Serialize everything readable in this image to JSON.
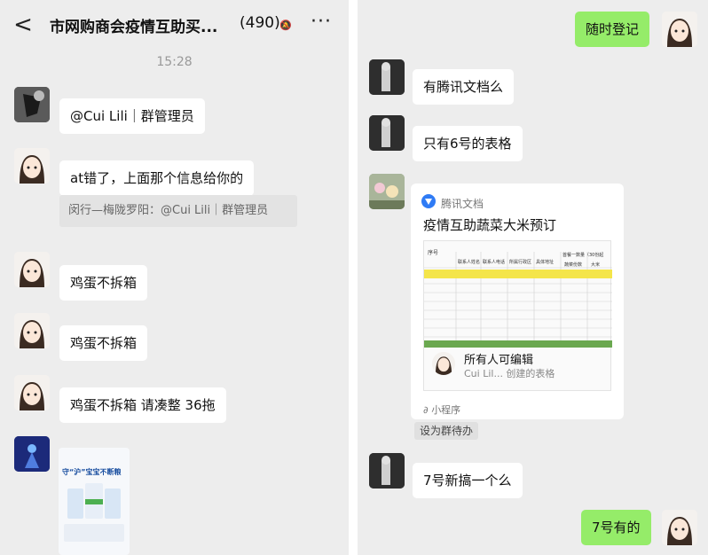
{
  "left": {
    "header": {
      "title": "市网购商会疫情互助买...",
      "member_count": "(490)",
      "back_glyph": "<",
      "more_glyph": "···"
    },
    "time_label": "15:28",
    "messages": [
      {
        "text": "@Cui Lili｜群管理员"
      },
      {
        "text": "at错了，上面那个信息给你的",
        "quote": "闵行—梅陇罗阳：@Cui Lili｜群管理员"
      },
      {
        "text": "鸡蛋不拆箱"
      },
      {
        "text": "鸡蛋不拆箱"
      },
      {
        "text": "鸡蛋不拆箱 请凑整 36拖"
      }
    ],
    "image_message": {
      "headline": "守“沪”宝宝不断粮"
    }
  },
  "right": {
    "messages": [
      {
        "text": "随时登记",
        "mine": true
      },
      {
        "text": "有腾讯文档么"
      },
      {
        "text": "只有6号的表格"
      },
      {
        "text": "7号新搞一个么"
      },
      {
        "text": "7号有的",
        "mine": true
      }
    ],
    "doc_card": {
      "source": "腾讯文档",
      "title": "疫情互助蔬菜大米预订",
      "owner_permission": "所有人可编辑",
      "owner_sub": "Cui Lil... 创建的表格",
      "footer": "小程序",
      "sheet_headers": [
        "序号",
        "联系人姓名",
        "联系人电话",
        "所属行政区",
        "具体地址",
        "首餐一数量（30份起",
        "蔬菜份数",
        "大米"
      ]
    },
    "notice_label": "设为群待办"
  },
  "colors": {
    "panel_bg": "#ededed",
    "my_bubble": "#95ec69",
    "other_bubble": "#ffffff",
    "sheet_highlight": "#f4e54a",
    "sheet_footer": "#6aa84f"
  }
}
